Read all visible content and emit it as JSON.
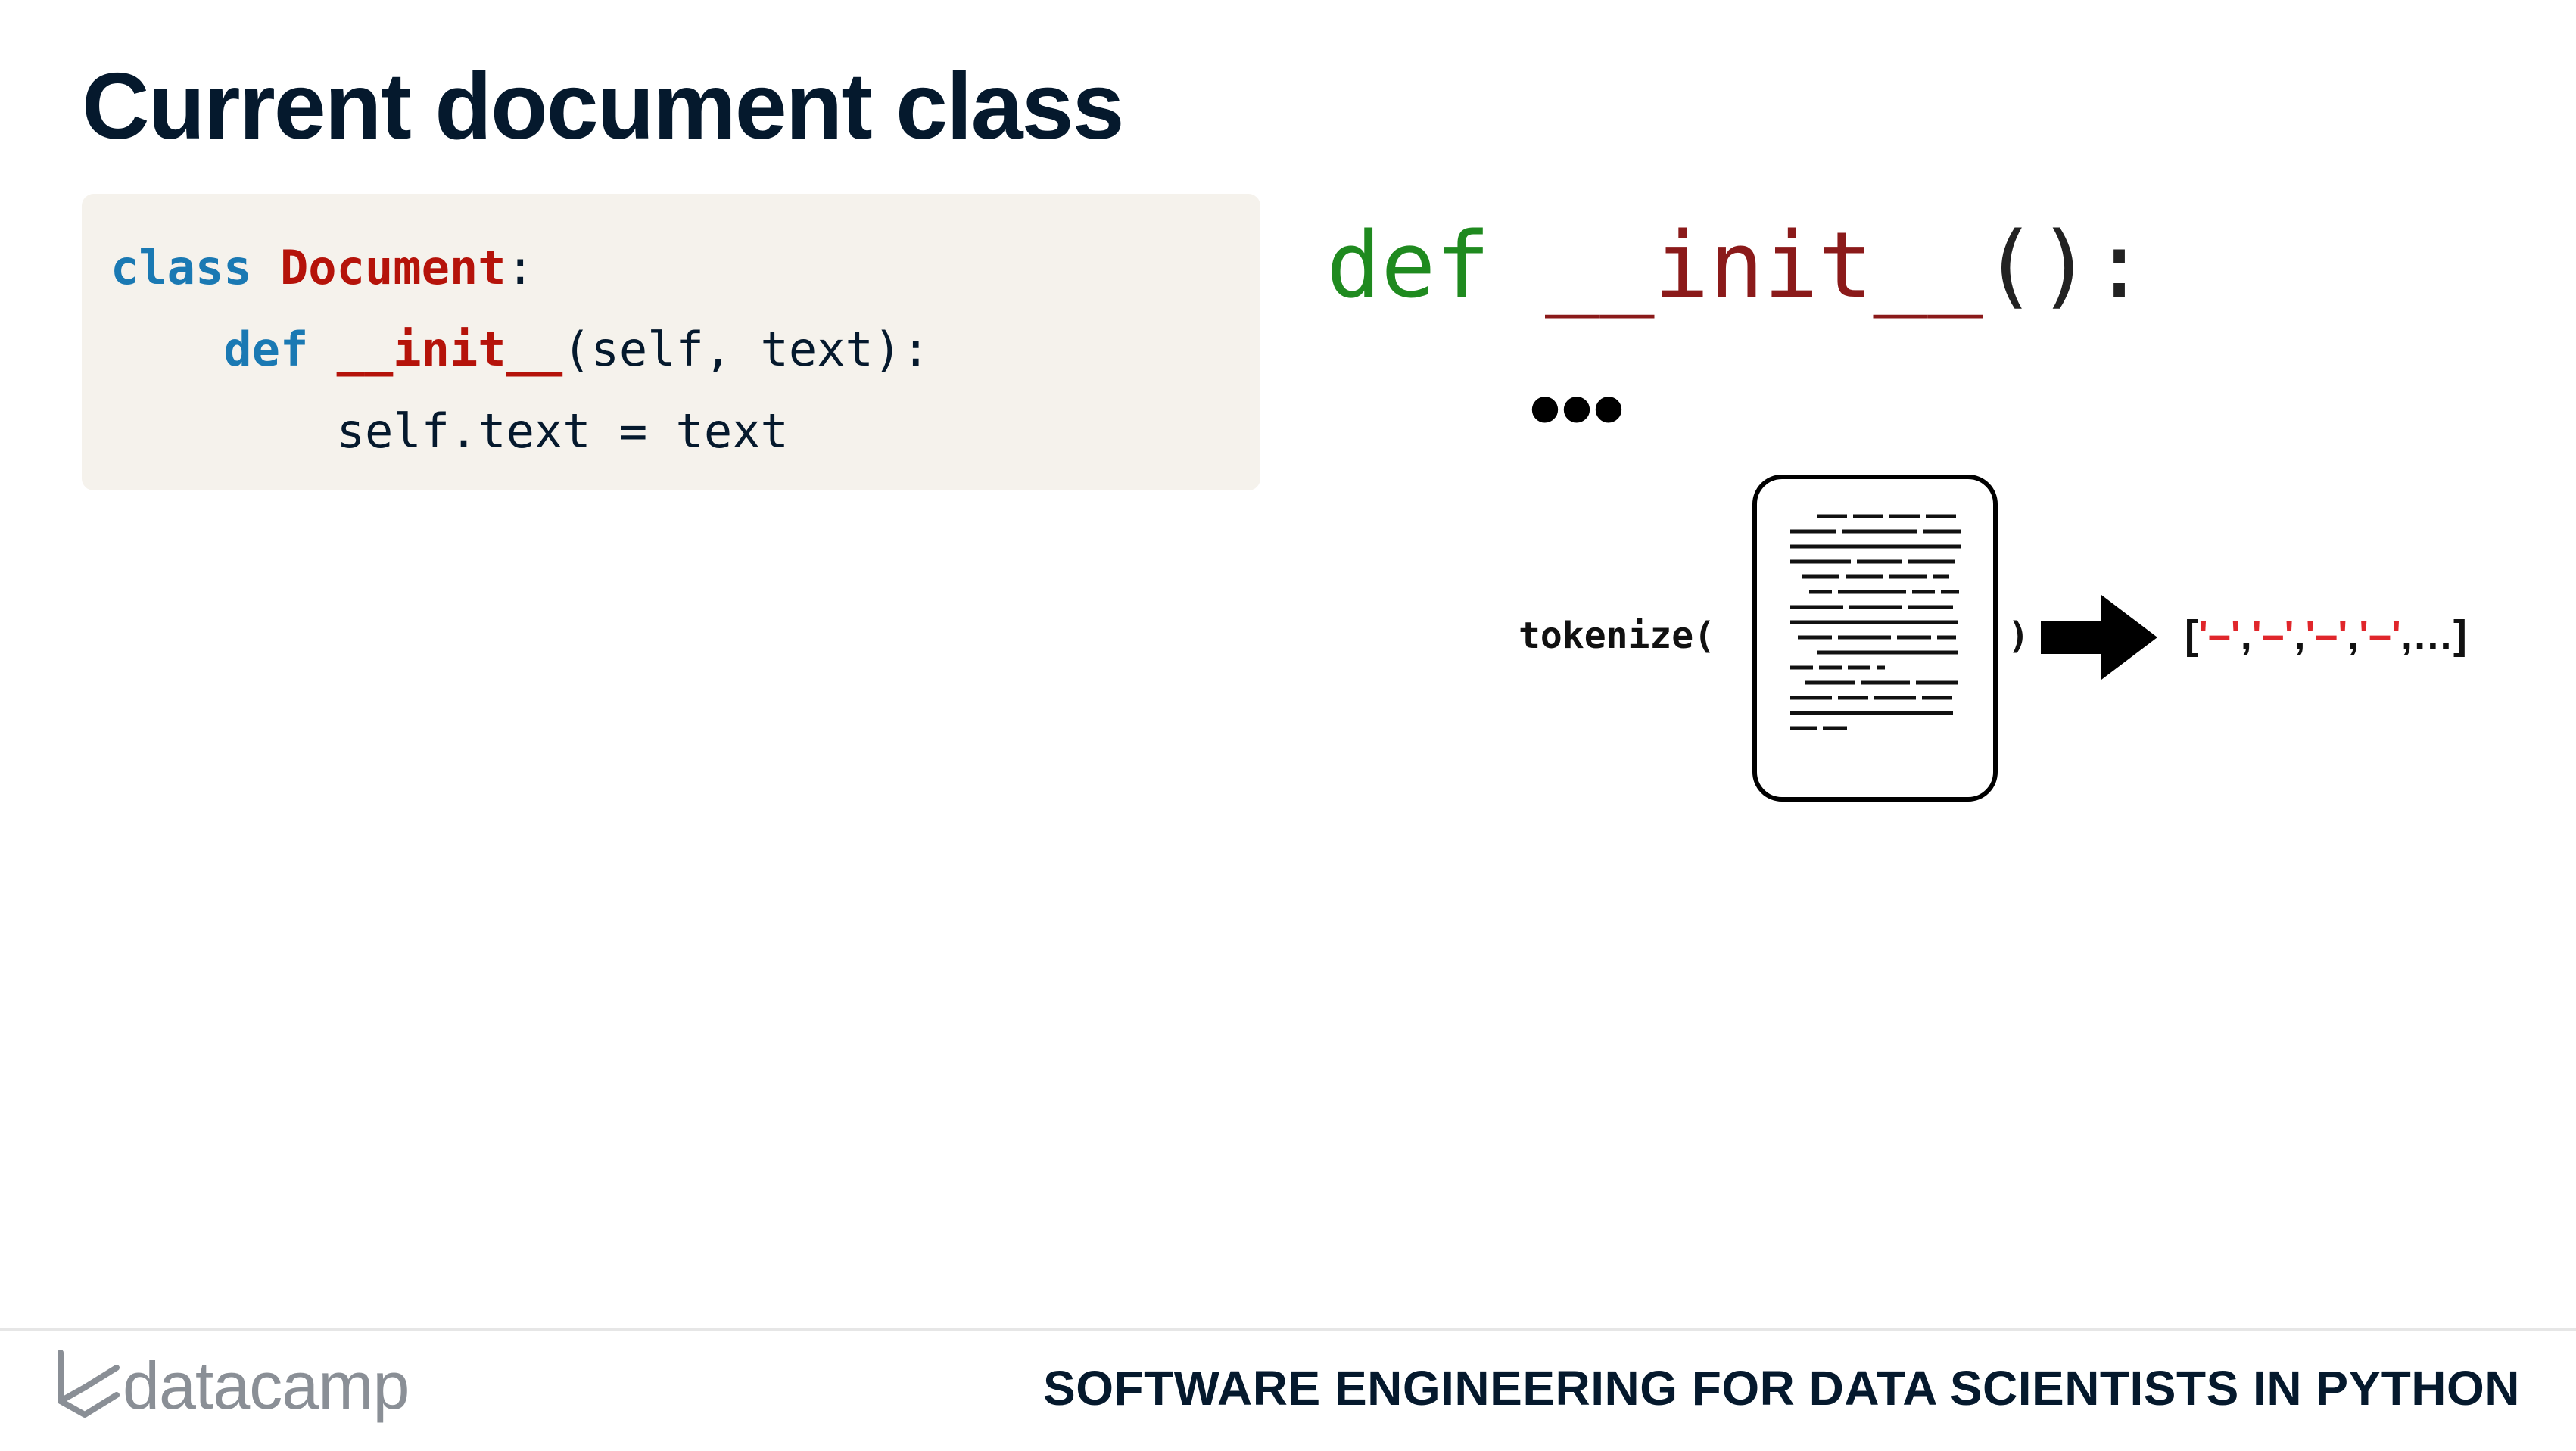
{
  "slide": {
    "title": "Current document class"
  },
  "code": {
    "kw_class": "class",
    "class_name": "Document",
    "colon": ":",
    "indent1": "    ",
    "kw_def": "def",
    "func_name": "__init__",
    "params": "(self, text):",
    "line3": "        self.text = text"
  },
  "illustration": {
    "def_kw": "def",
    "init_name": "__init__",
    "init_tail": "():",
    "ellipsis": "•••",
    "tokenize_label": "tokenize(",
    "close_paren": ")",
    "list_open": "[",
    "token": "'–'",
    "sep": ",",
    "list_close": "…]"
  },
  "footer": {
    "brand": "datacamp",
    "course_title": "SOFTWARE ENGINEERING FOR DATA SCIENTISTS IN PYTHON"
  },
  "colors": {
    "title": "#05192d",
    "code_keyword": "#1a79b3",
    "code_name": "#b5130a",
    "code_bg": "#f5f2ec",
    "def_green": "#1f8a1f",
    "init_red": "#8b1a1a",
    "token_red": "#e0262b"
  },
  "icons": {
    "document": "document-icon",
    "arrow": "arrow-right-icon",
    "logo": "datacamp-logo-icon"
  }
}
